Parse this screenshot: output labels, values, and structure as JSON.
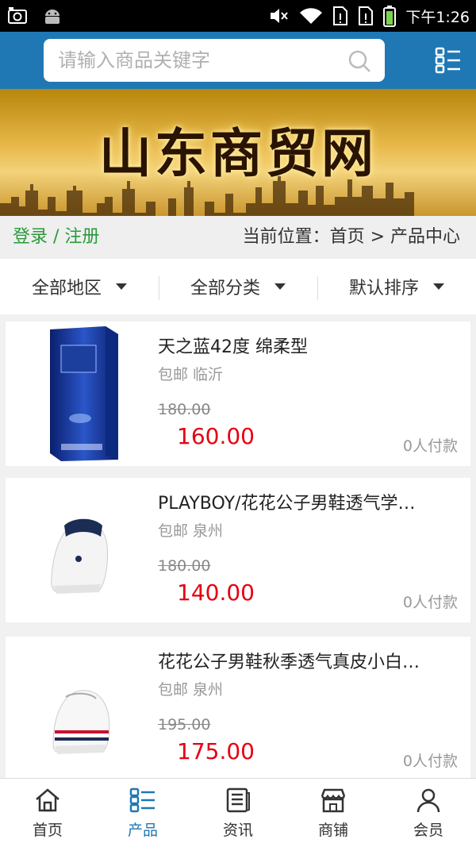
{
  "status": {
    "time": "下午1:26",
    "icons": [
      "camera-icon",
      "android-icon",
      "mute-icon",
      "wifi-icon",
      "sim-icon",
      "sim-icon",
      "battery-icon"
    ]
  },
  "search": {
    "placeholder": "请输入商品关键字"
  },
  "banner": {
    "title": "山东商贸网"
  },
  "crumb": {
    "login": "登录 / 注册",
    "position": "当前位置：首页 > 产品中心"
  },
  "filters": [
    "全部地区",
    "全部分类",
    "默认排序"
  ],
  "products": [
    {
      "title": "天之蓝42度 绵柔型",
      "location": "包邮 临沂",
      "old_price": "180.00",
      "price": "160.00",
      "sales": "0人付款",
      "image": "blue-liquor-box"
    },
    {
      "title": "PLAYBOY/花花公子男鞋透气学…",
      "location": "包邮 泉州",
      "old_price": "180.00",
      "price": "140.00",
      "sales": "0人付款",
      "image": "white-sneaker-navy"
    },
    {
      "title": "花花公子男鞋秋季透气真皮小白…",
      "location": "包邮 泉州",
      "old_price": "195.00",
      "price": "175.00",
      "sales": "0人付款",
      "image": "white-sneaker-stripes"
    }
  ],
  "tabs": [
    {
      "label": "首页",
      "icon": "home-icon"
    },
    {
      "label": "产品",
      "icon": "list-icon",
      "active": true
    },
    {
      "label": "资讯",
      "icon": "news-icon"
    },
    {
      "label": "商铺",
      "icon": "shop-icon"
    },
    {
      "label": "会员",
      "icon": "user-icon"
    }
  ],
  "colors": {
    "header": "#1f78b4",
    "price": "#e60012",
    "login": "#2a9a3a"
  }
}
